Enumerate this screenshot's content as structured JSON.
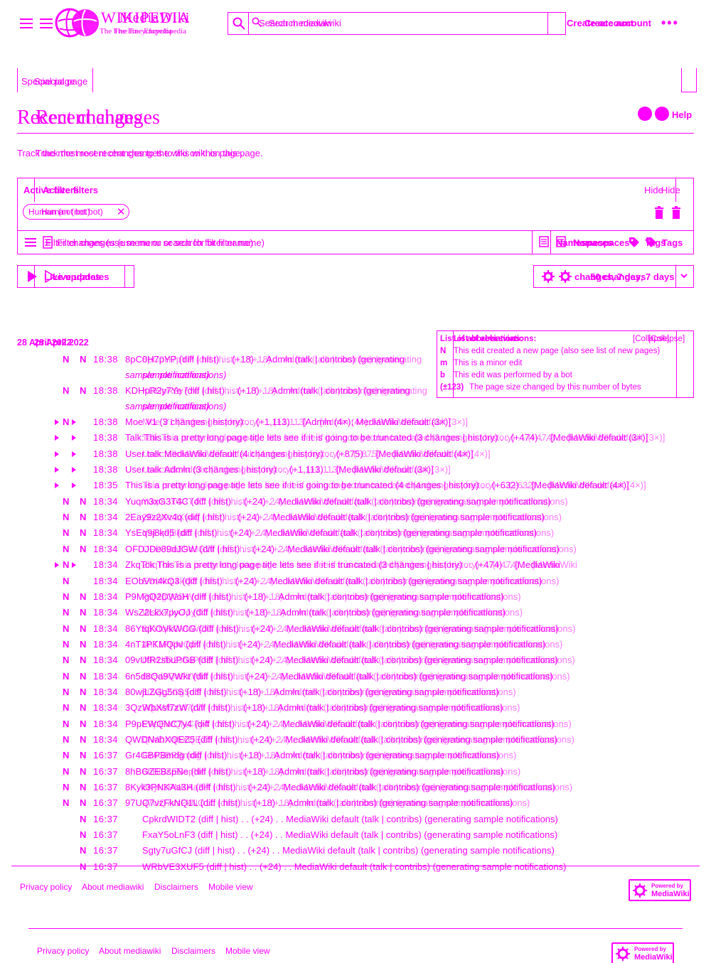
{
  "header": {
    "logo_word": "WIKIPEDIA",
    "logo_word_alt": "MediaWiki",
    "logo_tagline": "The Free Encyclopedia",
    "logo_tagline_alt": "The Free Encyclopedia",
    "search_placeholder": "Search mediawiki",
    "search_placeholder_alt": "Search mediawiki",
    "create_account": "Create account",
    "create_account_alt": "Create account",
    "more_dots": "•••"
  },
  "tabs": {
    "special_page": "Special page",
    "special_page_alt": "Special page"
  },
  "page": {
    "title": "Recent changes",
    "title_alt": "Recent changes",
    "help": "Help",
    "intro": "Track the most recent changes to the wiki on this page.",
    "intro_alt": "Track the most recent changes to this wiki on this page."
  },
  "filters": {
    "active_filters": "Active filters",
    "active_filters_alt": "Active filters",
    "hide": "Hide",
    "hide_alt": "Hide",
    "chip": "Human (not bot)",
    "chip_alt": "Human (not bot)",
    "chip_remove": "✕",
    "input_placeholder": "Filter changes (use menu or search for filter name)",
    "input_placeholder_alt": "Filter changes (use menu or search for filter name)",
    "namespaces": "Namespaces",
    "namespaces_alt": "Namespaces",
    "tags": "Tags",
    "tags_alt": "Tags"
  },
  "controls": {
    "live_updates": "Live updates",
    "live_updates_alt": "Live updates",
    "changes_days": "changes, 7 days",
    "changes_days_alt": "50 changes, 7 days"
  },
  "legend": {
    "title": "List of abbreviations:",
    "title_alt": "List of abbreviations:",
    "collapse": "[Collapse]",
    "collapse_alt": "[Collapse]",
    "items": [
      {
        "key": "N",
        "text": "This edit created a new page (also see list of new pages)"
      },
      {
        "key": "m",
        "text": "This is a minor edit"
      },
      {
        "key": "b",
        "text": "This edit was performed by a bot"
      },
      {
        "key": "(±123)",
        "text": "The page size changed by this number of bytes"
      }
    ]
  },
  "date_heading": "28 April 2022",
  "date_heading_alt": "28 April 2022",
  "changes": [
    {
      "marks": "N N",
      "tri": false,
      "time": "18:38",
      "text": "8pC0H7pYP (diff | hist) . . (+18) . . Admin (talk | contribs) (generating",
      "wrap": "sample notifications)"
    },
    {
      "marks": "N N",
      "tri": false,
      "time": "18:38",
      "text": "KDHpR2y7Ye (diff | hist) . . (+18) . . Admin (talk | contribs) (generating",
      "wrap": "sample notifications)"
    },
    {
      "marks": "N",
      "tri": true,
      "time": "18:38",
      "text": "Moe V1 (3 changes | history) . . (+1,113) . . [Admin (4×); MediaWiki default (3×)]"
    },
    {
      "marks": "",
      "tri": true,
      "time": "18:38",
      "text": "Talk:This is a pretty long page title lets see if it is going to be truncated (3 changes | history) . . (+474) . . [MediaWiki default (3×)]"
    },
    {
      "marks": "",
      "tri": true,
      "time": "18:38",
      "text": "User talk:MediaWiki default (4 changes | history) . . (+875) . . [MediaWiki default (4×)]"
    },
    {
      "marks": "",
      "tri": true,
      "time": "18:38",
      "text": "User talk:Admin (3 changes | history) . . (+1,113) . . [MediaWiki default (3×)]"
    },
    {
      "marks": "",
      "tri": true,
      "time": "18:35",
      "text": "This is a pretty long page title lets see if it is going to be truncated (4 changes | history) . . (+632) . . [MediaWiki default (4×)]"
    },
    {
      "marks": "N N",
      "tri": false,
      "time": "18:34",
      "text": "Yuqm3xG3T4C (diff | hist) . . (+24) . . MediaWiki default (talk | contribs) (generating sample notifications)"
    },
    {
      "marks": "N N",
      "tri": false,
      "time": "18:34",
      "text": "2Eay9z2Xv4q (diff | hist) . . (+24) . . MediaWiki default (talk | contribs) (generating sample notifications)"
    },
    {
      "marks": "N N",
      "tri": false,
      "time": "18:34",
      "text": "YsEq9j8kd5 (diff | hist) . . (+24) . . MediaWiki default (talk | contribs) (generating sample notifications)"
    },
    {
      "marks": "N N",
      "tri": false,
      "time": "18:34",
      "text": "OFDJDe89dJGW (diff | hist) . . (+24) . . MediaWiki default (talk | contribs) (generating sample notifications)"
    },
    {
      "marks": "N",
      "tri": true,
      "time": "18:34",
      "text": "ZkqTck This is a pretty long page title lets see if it is truncated (3 changes | history) . . (+474) . . [MediaWiki"
    },
    {
      "marks": "N",
      "tri": false,
      "time": "18:34",
      "text": "EObVm4kQ3 (diff | hist) . . (+24) . . MediaWiki default (talk | contribs) (generating sample notifications)"
    },
    {
      "marks": "N N",
      "tri": false,
      "time": "18:34",
      "text": "P9MgQ2DWoH (diff | hist) . . (+18) . . Admin (talk | contribs) (generating sample notifications)"
    },
    {
      "marks": "N N",
      "tri": false,
      "time": "18:34",
      "text": "WsZ2Lkx7pyOJ (diff | hist) . . (+18) . . Admin (talk | contribs) (generating sample notifications)"
    },
    {
      "marks": "N N",
      "tri": false,
      "time": "18:34",
      "text": "86YtqKOVkWCG (diff | hist) . . (+24) . . MediaWiki default (talk | contribs) (generating sample notifications)"
    },
    {
      "marks": "N N",
      "tri": false,
      "time": "18:34",
      "text": "4nT1PKMQpv (diff | hist) . . (+24) . . MediaWiki default (talk | contribs) (generating sample notifications)"
    },
    {
      "marks": "N N",
      "tri": false,
      "time": "18:34",
      "text": "09vUfR2sbuPGB (diff | hist) . . (+24) . . MediaWiki default (talk | contribs) (generating sample notifications)"
    },
    {
      "marks": "N N",
      "tri": false,
      "time": "18:34",
      "text": "6n5d8Qa9VWkt (diff | hist) . . (+24) . . MediaWiki default (talk | contribs) (generating sample notifications)"
    },
    {
      "marks": "N N",
      "tri": false,
      "time": "18:34",
      "text": "80wjLZGg5nS (diff | hist) . . (+18) . . Admin (talk | contribs) (generating sample notifications)"
    },
    {
      "marks": "N N",
      "tri": false,
      "time": "18:34",
      "text": "3QzWbXsf7zW (diff | hist) . . (+18) . . Admin (talk | contribs) (generating sample notifications)"
    },
    {
      "marks": "N N",
      "tri": false,
      "time": "18:34",
      "text": "P9pEWQNC7y4 (diff | hist) . . (+24) . . MediaWiki default (talk | contribs) (generating sample notifications)"
    },
    {
      "marks": "N N",
      "tri": false,
      "time": "18:34",
      "text": "QWDNahXQEZ5 (diff | hist) . . (+24) . . MediaWiki default (talk | contribs) (generating sample notifications)"
    },
    {
      "marks": "N N",
      "tri": false,
      "time": "16:37",
      "text": "Gr4GBPBmdg (diff | hist) . . (+18) . . Admin (talk | contribs) (generating sample notifications)"
    },
    {
      "marks": "N N",
      "tri": false,
      "time": "16:37",
      "text": "8hBGZEBspNe (diff | hist) . . (+18) . . Admin (talk | contribs) (generating sample notifications)"
    },
    {
      "marks": "N N",
      "tri": false,
      "time": "16:37",
      "text": "8Kyk3PNKAa3H (diff | hist) . . (+24) . . MediaWiki default (talk | contribs) (generating sample notifications)"
    },
    {
      "marks": "N N",
      "tri": false,
      "time": "16:37",
      "text": "97UQ7vzFkNQ1L (diff | hist) . . (+18) . . Admin (talk | contribs) (generating sample notifications)"
    },
    {
      "marks": "N",
      "tri": false,
      "time": "16:37",
      "text": "CpkrdWIDT2 (diff | hist) . . (+24) . . MediaWiki default (talk | contribs) (generating sample notifications)",
      "shift": true
    },
    {
      "marks": "N",
      "tri": false,
      "time": "16:37",
      "text": "FxaY5oLnF3 (diff | hist) . . (+24) . . MediaWiki default (talk | contribs) (generating sample notifications)",
      "shift": true
    },
    {
      "marks": "N",
      "tri": false,
      "time": "16:37",
      "text": "Sgty7uGfCJ (diff | hist) . . (+24) . . MediaWiki default (talk | contribs) (generating sample notifications)",
      "shift": true
    },
    {
      "marks": "N",
      "tri": false,
      "time": "16:37",
      "text": "WRbVE3XUF5 (diff | hist) . . (+24) . . MediaWiki default (talk | contribs) (generating sample notifications)",
      "shift": true
    }
  ],
  "footer": {
    "links": [
      "Privacy policy",
      "About mediawiki",
      "Disclaimers",
      "Mobile view"
    ],
    "powered_top": "Powered by",
    "powered_bottom": "MediaWiki"
  }
}
